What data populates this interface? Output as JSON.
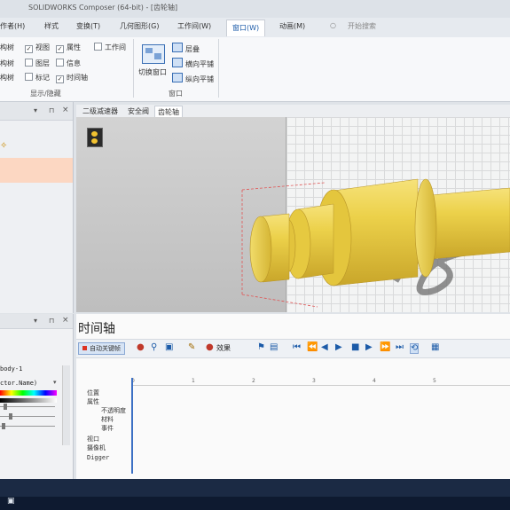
{
  "window": {
    "title": "SOLIDWORKS Composer (64-bit) - [齿轮轴]"
  },
  "menu": {
    "tabs": [
      "作者(H)",
      "样式",
      "变换(T)",
      "几何图形(G)",
      "工作间(W)",
      "窗口(W)",
      "动画(M)"
    ],
    "search_label": "开始搜索"
  },
  "ribbon": {
    "show_hide": {
      "rows": [
        [
          {
            "label": "构树",
            "checked": true
          },
          {
            "label": "视图",
            "checked": true
          },
          {
            "label": "属性",
            "checked": true
          },
          {
            "label": "工作间",
            "checked": false
          }
        ],
        [
          {
            "label": "构树",
            "checked": false
          },
          {
            "label": "图层",
            "checked": false
          },
          {
            "label": "信息",
            "checked": false
          }
        ],
        [
          {
            "label": "构树",
            "checked": false
          },
          {
            "label": "标记",
            "checked": false
          },
          {
            "label": "时间轴",
            "checked": true
          }
        ]
      ],
      "group_label": "显示/隐藏"
    },
    "window_group": {
      "switch_label": "切换窗口",
      "cascade_label": "层叠",
      "tile_h_label": "横向平铺",
      "tile_v_label": "纵向平铺",
      "group_label": "窗口"
    }
  },
  "doc_tabs": [
    "二级减速器",
    "安全阀",
    "齿轮轴"
  ],
  "property_panel": {
    "item1": "body-1",
    "item2": "ctor.Name)"
  },
  "timeline": {
    "title": "时间轴",
    "auto_key_label": "自动关键帧",
    "effects_label": "效果",
    "ruler_ticks": [
      "0",
      "1",
      "2",
      "3",
      "4",
      "5"
    ],
    "tracks": [
      "位置",
      "属性",
      "不透明度",
      "材料",
      "事件",
      "视口",
      "摄像机",
      "Digger"
    ]
  },
  "colors": {
    "accent": "#1c5ba8",
    "part": "#e8c83c",
    "selection": "#fcd7c2",
    "taskbar": "#1b2a44"
  }
}
